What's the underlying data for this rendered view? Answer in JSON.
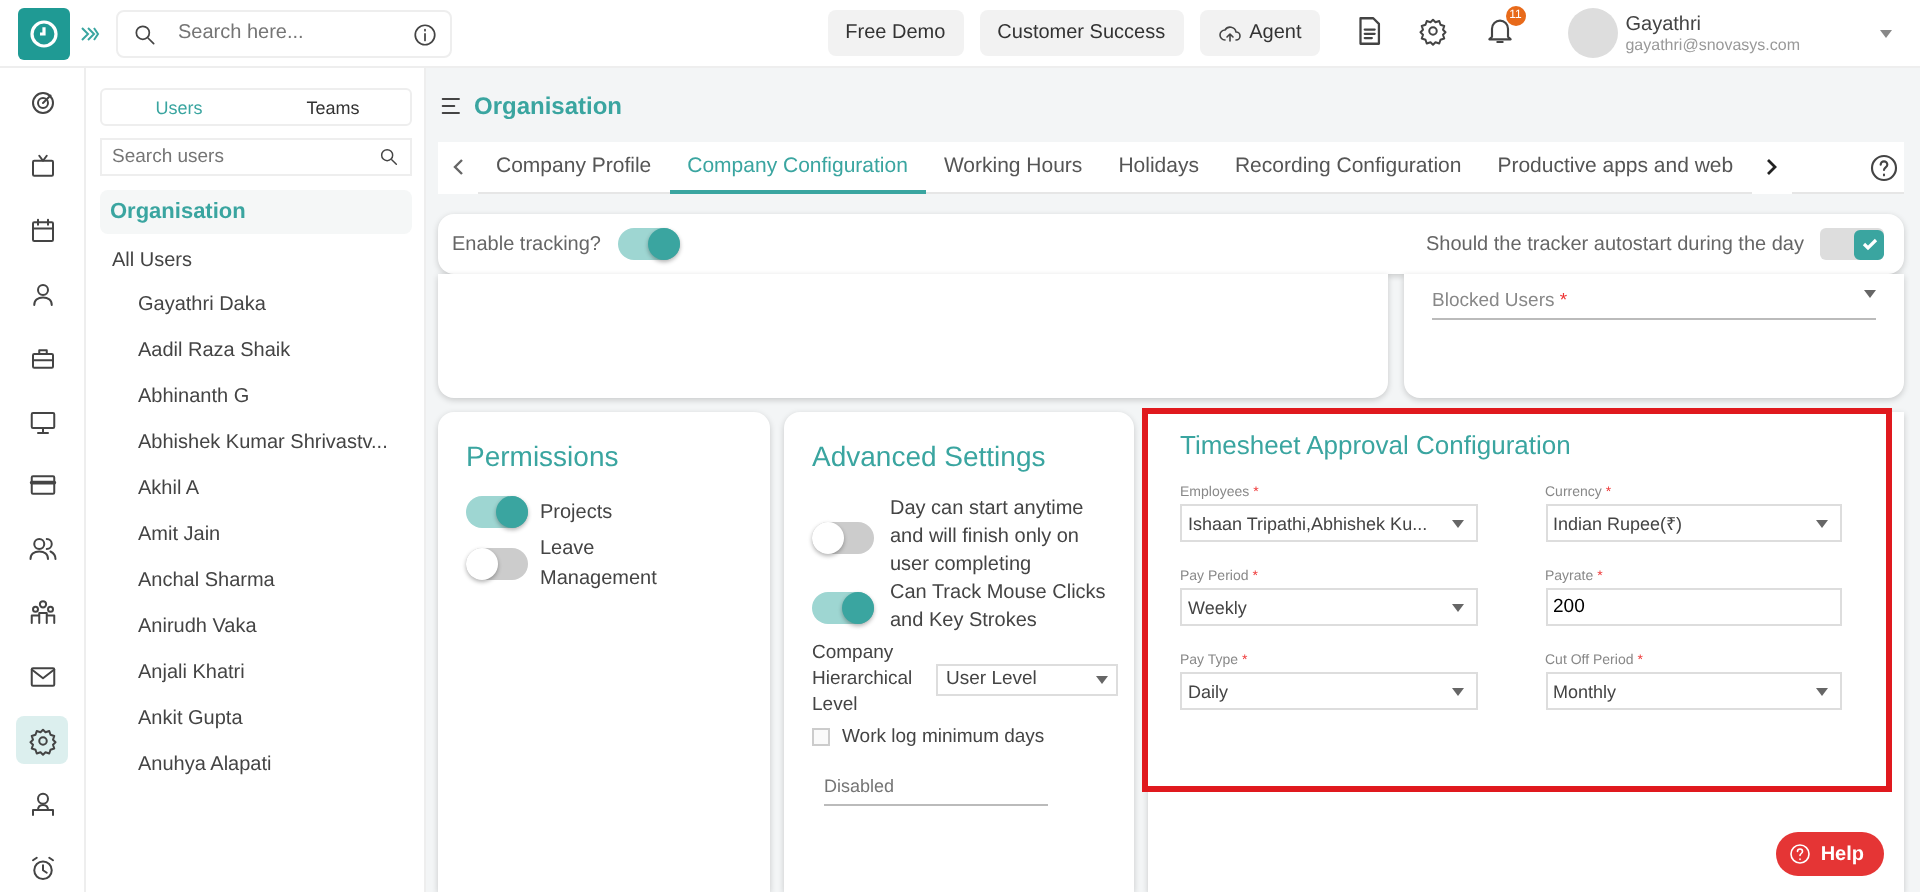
{
  "topbar": {
    "search": {
      "placeholder": "Search here..."
    },
    "buttons": [
      {
        "label": "Free Demo",
        "kind": "plain"
      },
      {
        "label": "Customer Success",
        "kind": "plain"
      },
      {
        "label": "Agent",
        "kind": "cloud"
      }
    ],
    "notification_count": "11",
    "user": {
      "name": "Gayathri",
      "email": "gayathri@snovasys.com"
    }
  },
  "nav": [
    {
      "kind": "target",
      "selected": false
    },
    {
      "kind": "tv",
      "selected": false
    },
    {
      "kind": "calendar",
      "selected": false
    },
    {
      "kind": "user",
      "selected": false
    },
    {
      "kind": "briefcase",
      "selected": false
    },
    {
      "kind": "monitor",
      "selected": false
    },
    {
      "kind": "card",
      "selected": false
    },
    {
      "kind": "users",
      "selected": false
    },
    {
      "kind": "team",
      "selected": false
    },
    {
      "kind": "mail",
      "selected": false
    },
    {
      "kind": "gear",
      "selected": true
    },
    {
      "kind": "person-desk",
      "selected": false
    },
    {
      "kind": "alarm",
      "selected": false
    }
  ],
  "user_panel": {
    "tabs": [
      {
        "label": "Users",
        "selected": true
      },
      {
        "label": "Teams",
        "selected": false
      }
    ],
    "search": {
      "placeholder": "Search users"
    },
    "heading": "Organisation",
    "all_users": "All Users",
    "users": [
      "Gayathri Daka",
      "Aadil Raza Shaik",
      "Abhinanth G",
      "Abhishek Kumar Shrivastv...",
      "Akhil A",
      "Amit Jain",
      "Anchal Sharma",
      "Anirudh Vaka",
      "Anjali Khatri",
      "Ankit Gupta",
      "Anuhya Alapati"
    ]
  },
  "page": {
    "title": "Organisation",
    "tabs": [
      {
        "label": "Company Profile",
        "selected": false
      },
      {
        "label": "Company Configuration",
        "selected": true
      },
      {
        "label": "Working Hours",
        "selected": false
      },
      {
        "label": "Holidays",
        "selected": false
      },
      {
        "label": "Recording Configuration",
        "selected": false
      },
      {
        "label": "Productive apps and web",
        "selected": false
      }
    ]
  },
  "tracking": {
    "enable_label": "Enable tracking?",
    "enable_on": true,
    "autostart_label": "Should the tracker autostart during the day",
    "autostart_checked": true
  },
  "blocked_users": {
    "placeholder": "Blocked Users",
    "required": "*"
  },
  "permissions": {
    "title": "Permissions",
    "items": [
      {
        "label": "Projects",
        "on": true
      },
      {
        "label": "Leave Management",
        "on": false
      }
    ]
  },
  "advanced": {
    "title": "Advanced Settings",
    "toggles": [
      {
        "label": "Day can start anytime and will finish only on user completing",
        "on": false
      },
      {
        "label": "Can Track Mouse Clicks and Key Strokes",
        "on": true
      }
    ],
    "hierarchy_label": "Company Hierarchical Level",
    "hierarchy_value": "User Level",
    "worklog_label": "Work log minimum days",
    "worklog_checked": false,
    "worklog_placeholder": "Disabled"
  },
  "timesheet": {
    "title": "Timesheet Approval Configuration",
    "fields": [
      {
        "label": "Employees",
        "kind": "select",
        "value": "Ishaan Tripathi,Abhishek Ku..."
      },
      {
        "label": "Currency",
        "kind": "select",
        "value": "Indian Rupee(₹)"
      },
      {
        "label": "Pay Period",
        "kind": "select",
        "value": "Weekly"
      },
      {
        "label": "Payrate",
        "kind": "input",
        "value": "200"
      },
      {
        "label": "Pay Type",
        "kind": "select",
        "value": "Daily"
      },
      {
        "label": "Cut Off Period",
        "kind": "select",
        "value": "Monthly"
      }
    ],
    "required": "*"
  },
  "help_button": "Help"
}
